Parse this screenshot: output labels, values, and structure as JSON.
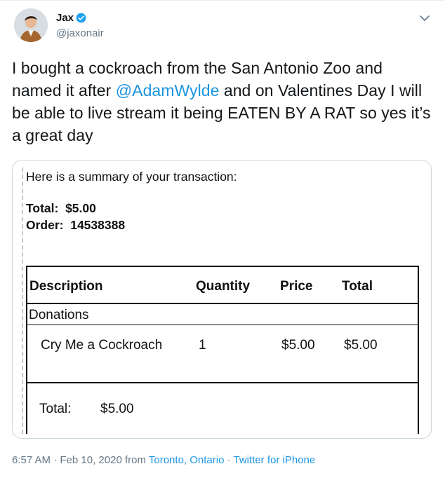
{
  "author": {
    "display_name": "Jax",
    "handle": "@jaxonair"
  },
  "tweet": {
    "text_before": "I bought a cockroach from the San Antonio Zoo and named it after ",
    "mention": "@AdamWylde",
    "text_after": " and on Valentines Day I will be able to live stream it being EATEN BY A RAT so yes it’s a great day"
  },
  "receipt": {
    "intro": "Here is a summary of your transaction:",
    "total_label": "Total:",
    "total_value": "$5.00",
    "order_label": "Order:",
    "order_value": "14538388",
    "table": {
      "headers": [
        "Description",
        "Quantity",
        "Price",
        "Total"
      ],
      "section": "Donations",
      "item": {
        "description": "Cry Me a Cockroach",
        "quantity": "1",
        "price": "$5.00",
        "total": "$5.00"
      },
      "footer_label": "Total:",
      "footer_value": "$5.00"
    }
  },
  "meta": {
    "time": "6:57 AM",
    "sep1": " · ",
    "date": "Feb 10, 2020",
    "from": " from ",
    "location": "Toronto, Ontario",
    "sep2": " · ",
    "source": "Twitter for iPhone"
  },
  "colors": {
    "link": "#1b95e0",
    "secondary_text": "#657786",
    "verified": "#1da1f2"
  }
}
